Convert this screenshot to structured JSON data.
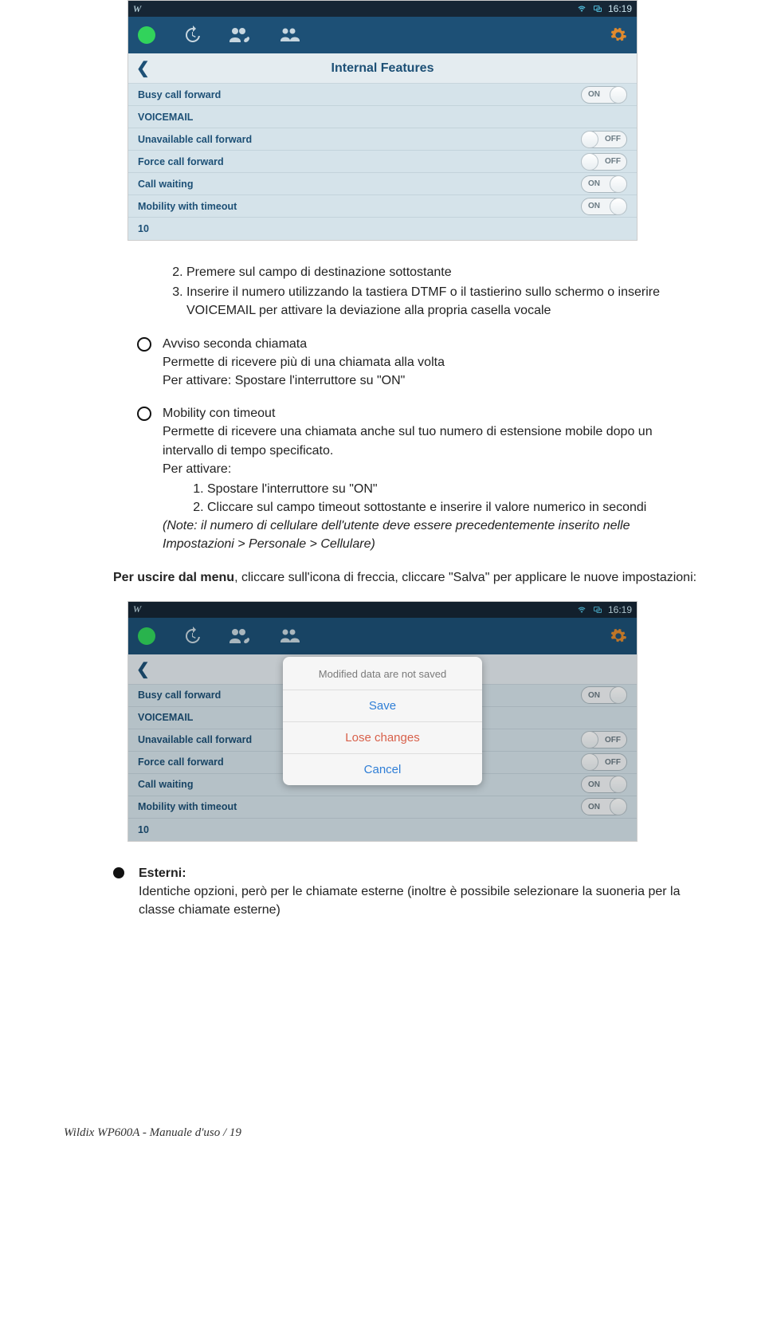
{
  "statusbar": {
    "logo": "W",
    "time": "16:19"
  },
  "phone": {
    "screen_title": "Internal Features",
    "rows": {
      "busy": "Busy call forward",
      "voicemail": "VOICEMAIL",
      "unavail": "Unavailable call forward",
      "force": "Force call forward",
      "waiting": "Call waiting",
      "mobility": "Mobility with timeout",
      "timeout_val": "10"
    },
    "toggle": {
      "on": "ON",
      "off": "OFF"
    }
  },
  "modal": {
    "title": "Modified data are not saved",
    "save": "Save",
    "lose": "Lose changes",
    "cancel": "Cancel"
  },
  "text": {
    "ol": {
      "i2": "Premere sul campo di destinazione sottostante",
      "i3": "Inserire il numero utilizzando la tastiera DTMF o il tastierino sullo schermo o inserire VOICEMAIL per attivare la deviazione alla propria casella vocale"
    },
    "c1": {
      "title": "Avviso seconda chiamata",
      "l1": "Permette di ricevere più di una chiamata alla volta",
      "l2": "Per attivare: Spostare l'interruttore su \"ON\""
    },
    "c2": {
      "title": "Mobility con timeout",
      "l1": "Permette di ricevere una chiamata anche sul tuo numero di estensione mobile dopo un intervallo di tempo specificato.",
      "l2": "Per attivare:",
      "s1": "Spostare l'interruttore su \"ON\"",
      "s2": "Cliccare sul campo timeout sottostante e inserire il valore numerico in secondi",
      "note": "(Note: il numero di cellulare dell'utente deve essere precedentemente inserito nelle Impostazioni > Personale > Cellulare)"
    },
    "exit_bold": "Per uscire dal menu",
    "exit_rest": ", cliccare sull'icona di freccia, cliccare \"Salva\" per applicare le nuove impostazioni:",
    "esterni_title": "Esterni:",
    "esterni_body": "Identiche opzioni, però per le chiamate esterne (inoltre è possibile selezionare la suoneria per la classe chiamate esterne)"
  },
  "footer": "Wildix WP600A - Manuale d'uso / 19"
}
